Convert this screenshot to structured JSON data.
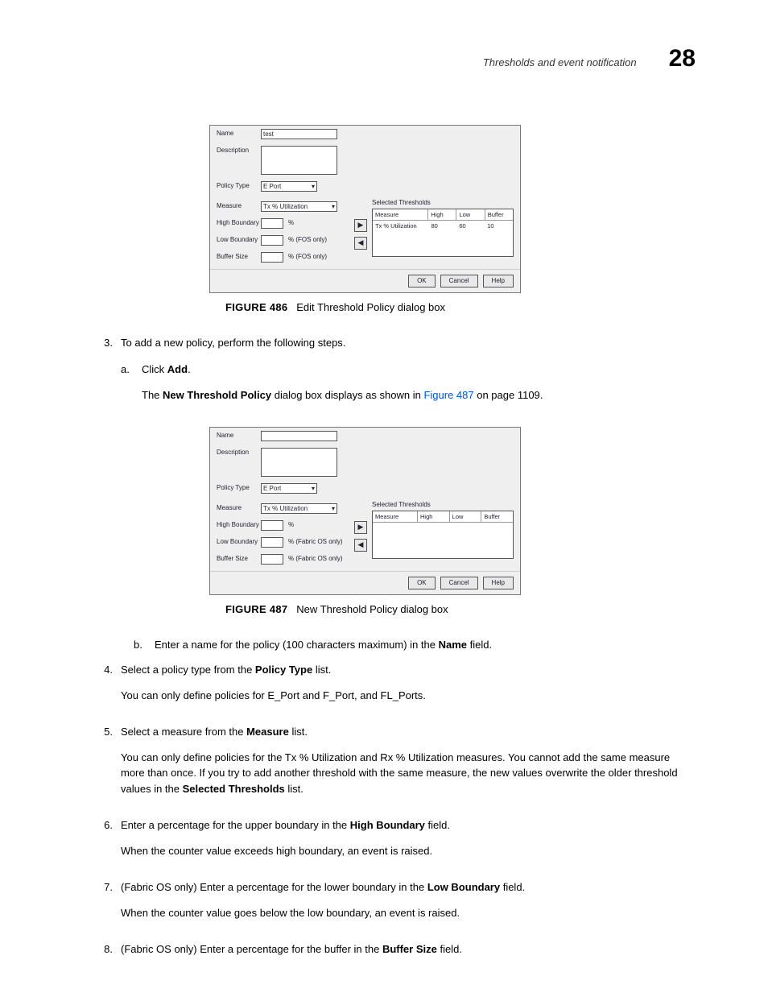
{
  "header": {
    "section": "Thresholds and event notification",
    "chapter": "28"
  },
  "fig486": {
    "caption_label": "FIGURE 486",
    "caption_text": "Edit Threshold Policy dialog box",
    "labels": {
      "name": "Name",
      "description": "Description",
      "policy_type": "Policy Type",
      "measure": "Measure",
      "high_boundary": "High Boundary",
      "low_boundary": "Low Boundary",
      "buffer_size": "Buffer Size",
      "selected": "Selected Thresholds"
    },
    "name_value": "test",
    "policy_type_value": "E Port",
    "measure_value": "Tx % Utilization",
    "high_unit": "%",
    "low_unit": "% (FOS only)",
    "buffer_unit": "% (FOS only)",
    "columns": [
      "Measure",
      "High",
      "Low",
      "Buffer"
    ],
    "row": {
      "measure": "Tx % Utilization",
      "high": "80",
      "low": "60",
      "buffer": "10"
    },
    "buttons": {
      "ok": "OK",
      "cancel": "Cancel",
      "help": "Help"
    }
  },
  "fig487": {
    "caption_label": "FIGURE 487",
    "caption_text": "New Threshold Policy dialog box",
    "labels": {
      "name": "Name",
      "description": "Description",
      "policy_type": "Policy Type",
      "measure": "Measure",
      "high_boundary": "High Boundary",
      "low_boundary": "Low Boundary",
      "buffer_size": "Buffer Size",
      "selected": "Selected Thresholds"
    },
    "policy_type_value": "E Port",
    "measure_value": "Tx % Utilization",
    "high_unit": "%",
    "low_unit": "% (Fabric OS only)",
    "buffer_unit": "% (Fabric OS only)",
    "columns": [
      "Measure",
      "High",
      "Low",
      "Buffer"
    ],
    "buttons": {
      "ok": "OK",
      "cancel": "Cancel",
      "help": "Help"
    }
  },
  "steps": {
    "s3_intro": "To add a new policy, perform the following steps.",
    "s3a_pre": "Click ",
    "s3a_bold": "Add",
    "s3a_post": ".",
    "s3a_sentence_pre": "The ",
    "s3a_sentence_bold": "New Threshold Policy",
    "s3a_sentence_mid": " dialog box displays as shown in ",
    "s3a_sentence_link": "Figure 487",
    "s3a_sentence_end": " on page 1109.",
    "s3b_pre": "Enter a name for the policy (100 characters maximum) in the ",
    "s3b_bold": "Name",
    "s3b_post": " field.",
    "s4_pre": "Select a policy type from the ",
    "s4_bold": "Policy Type",
    "s4_post": " list.",
    "s4_para": "You can only define policies for E_Port and F_Port, and FL_Ports.",
    "s5_pre": "Select a measure from the ",
    "s5_bold": "Measure",
    "s5_post": " list.",
    "s5_para_pre": "You can only define policies for the Tx % Utilization and Rx % Utilization measures. You cannot add the same measure more than once. If you try to add another threshold with the same measure, the new values overwrite the older threshold values in the ",
    "s5_para_bold": "Selected Thresholds",
    "s5_para_post": " list.",
    "s6_pre": "Enter a percentage for the upper boundary in the ",
    "s6_bold": "High Boundary",
    "s6_post": " field.",
    "s6_para": "When the counter value exceeds high boundary, an event is raised.",
    "s7_pre": "(Fabric OS only) Enter a percentage for the lower boundary in the ",
    "s7_bold": "Low Boundary",
    "s7_post": " field.",
    "s7_para": "When the counter value goes below the low boundary, an event is raised.",
    "s8_pre": "(Fabric OS only) Enter a percentage for the buffer in the ",
    "s8_bold": "Buffer Size",
    "s8_post": " field."
  },
  "nums": {
    "n3": "3.",
    "n4": "4.",
    "n5": "5.",
    "n6": "6.",
    "n7": "7.",
    "n8": "8.",
    "la": "a.",
    "lb": "b."
  }
}
